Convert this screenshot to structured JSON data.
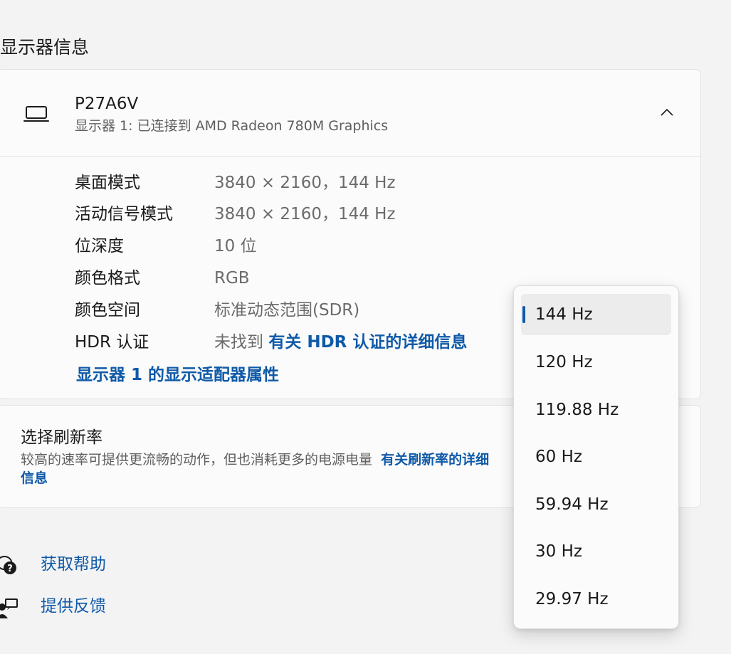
{
  "section": {
    "title": "显示器信息"
  },
  "display": {
    "name": "P27A6V",
    "subtitle": "显示器 1: 已连接到 AMD Radeon 780M Graphics",
    "rows": [
      {
        "label": "桌面模式",
        "value": "3840 × 2160，144 Hz"
      },
      {
        "label": "活动信号模式",
        "value": "3840 × 2160，144 Hz"
      },
      {
        "label": "位深度",
        "value": "10 位"
      },
      {
        "label": "颜色格式",
        "value": "RGB"
      },
      {
        "label": "颜色空间",
        "value": "标准动态范围(SDR)"
      }
    ],
    "hdr": {
      "label": "HDR 认证",
      "value": "未找到",
      "link": "有关 HDR 认证的详细信息"
    },
    "adapter_link": "显示器 1 的显示适配器属性"
  },
  "refresh": {
    "title": "选择刷新率",
    "description": "较高的速率可提供更流畅的动作，但也消耗更多的电源电量",
    "link": "有关刷新率的详细信息"
  },
  "help": {
    "get_help": "获取帮助",
    "feedback": "提供反馈"
  },
  "dropdown": {
    "selected": "144 Hz",
    "options": [
      "144 Hz",
      "120 Hz",
      "119.88 Hz",
      "60 Hz",
      "59.94 Hz",
      "30 Hz",
      "29.97 Hz"
    ]
  },
  "colors": {
    "accent": "#0f5aa8",
    "background": "#f3f3f3",
    "card": "#fbfbfb"
  }
}
